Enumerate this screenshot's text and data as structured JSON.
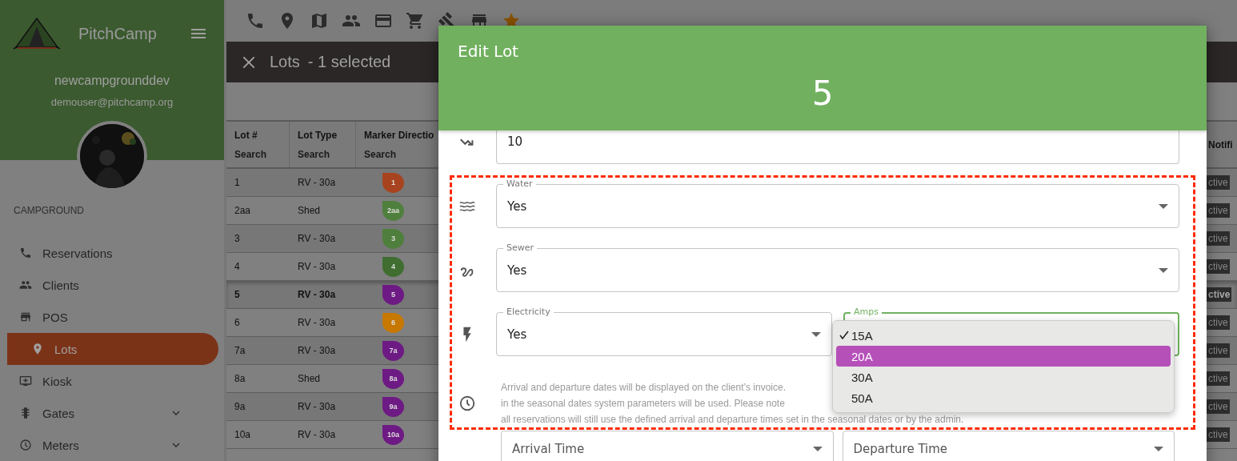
{
  "sidebar": {
    "brand": "PitchCamp",
    "account": "newcampgrounddev",
    "email": "demouser@pitchcamp.org",
    "section": "CAMPGROUND",
    "items": [
      {
        "label": "Reservations",
        "kind": "link",
        "selected": false
      },
      {
        "label": "Clients",
        "kind": "link",
        "selected": false
      },
      {
        "label": "POS",
        "kind": "link",
        "selected": false
      },
      {
        "label": "Lots",
        "kind": "link",
        "selected": true
      },
      {
        "label": "Kiosk",
        "kind": "link",
        "selected": false
      },
      {
        "label": "Gates",
        "kind": "group",
        "selected": false
      },
      {
        "label": "Meters",
        "kind": "group",
        "selected": false
      }
    ]
  },
  "selection_bar": {
    "title": "Lots",
    "count": "- 1 selected"
  },
  "table": {
    "columns": [
      {
        "label": "Lot #",
        "placeholder": "Search"
      },
      {
        "label": "Lot Type",
        "placeholder": "Search"
      },
      {
        "label": "Marker Directio",
        "placeholder": "Search"
      },
      {
        "label": "Notifi"
      }
    ],
    "rows": [
      {
        "lot": "1",
        "type": "RV - 30a",
        "marker": "1",
        "color": "#a8431f",
        "status": "ctive",
        "selected": false
      },
      {
        "lot": "2aa",
        "type": "Shed",
        "marker": "2aa",
        "color": "#4f7f3c",
        "status": "ctive",
        "selected": false
      },
      {
        "lot": "3",
        "type": "RV - 30a",
        "marker": "3",
        "color": "#4f7f3c",
        "status": "ctive",
        "selected": false
      },
      {
        "lot": "4",
        "type": "RV - 30a",
        "marker": "4",
        "color": "#3f6e30",
        "status": "ctive",
        "selected": false
      },
      {
        "lot": "5",
        "type": "RV - 30a",
        "marker": "5",
        "color": "#6e1a84",
        "status": "ctive",
        "selected": true
      },
      {
        "lot": "6",
        "type": "RV - 30a",
        "marker": "6",
        "color": "#c77800",
        "status": "ctive",
        "selected": false
      },
      {
        "lot": "7a",
        "type": "RV - 30a",
        "marker": "7a",
        "color": "#6e1a84",
        "status": "ctive",
        "selected": false
      },
      {
        "lot": "8a",
        "type": "Shed",
        "marker": "8a",
        "color": "#6e1a84",
        "status": "ctive",
        "selected": false
      },
      {
        "lot": "9a",
        "type": "RV - 30a",
        "marker": "9a",
        "color": "#6e1a84",
        "status": "ctive",
        "selected": false
      },
      {
        "lot": "10a",
        "type": "RV - 30a",
        "marker": "10a",
        "color": "#6e1a84",
        "status": "ctive",
        "selected": false
      }
    ]
  },
  "modal": {
    "title": "Edit Lot",
    "lot": "5",
    "rows": [
      {
        "fields": [
          {
            "kind": "text",
            "value": "10"
          }
        ]
      },
      {
        "fields": [
          {
            "kind": "select",
            "label": "Water",
            "value": "Yes",
            "focused": false
          }
        ]
      },
      {
        "fields": [
          {
            "kind": "select",
            "label": "Sewer",
            "value": "Yes",
            "focused": false
          }
        ]
      },
      {
        "fields": [
          {
            "kind": "select",
            "label": "Electricity",
            "value": "Yes",
            "focused": false
          },
          {
            "kind": "select",
            "label": "Amps",
            "focused": true
          }
        ]
      }
    ],
    "note": [
      "Arrival and departure dates will be displayed on the client’s invoice.",
      "in the seasonal dates system parameters will be used. Please note",
      "all reservations will still use the defined arrival and departure times set in the seasonal dates or by the admin."
    ],
    "time_fields": [
      {
        "placeholder": "Arrival Time"
      },
      {
        "placeholder": "Departure Time"
      }
    ],
    "amps_menu": {
      "options": [
        {
          "label": "15A",
          "checked": true,
          "highlighted": false
        },
        {
          "label": "20A",
          "checked": false,
          "highlighted": true
        },
        {
          "label": "30A",
          "checked": false,
          "highlighted": false
        },
        {
          "label": "50A",
          "checked": false,
          "highlighted": false
        }
      ]
    },
    "annotation_frame": true
  }
}
